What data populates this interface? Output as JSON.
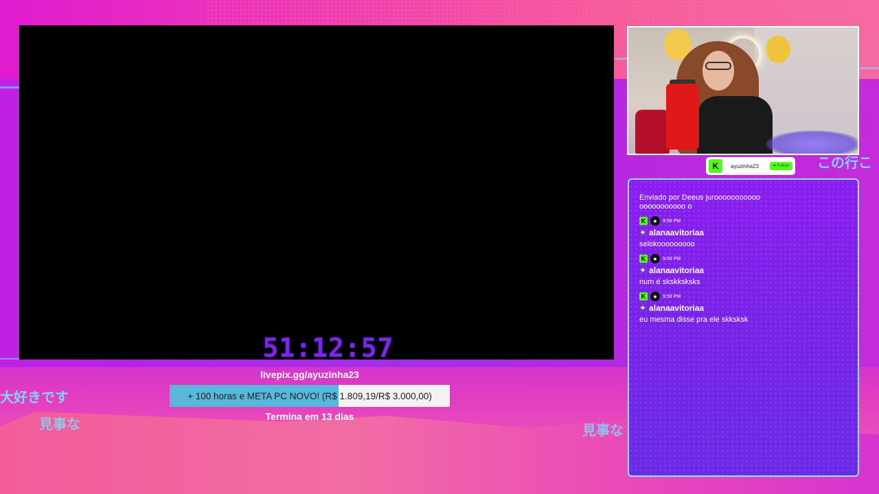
{
  "overlay": {
    "jp_texts": [
      "大好きです",
      "見事な",
      "見事な",
      "この行こ"
    ]
  },
  "stream": {
    "countdown": "51:12:57"
  },
  "webcam": {
    "alt": "streamer webcam"
  },
  "follow_bar": {
    "badge": "K",
    "channel": "ayuzinha23",
    "button_label": "Follow"
  },
  "chat": {
    "messages": [
      {
        "text": "Enviado por Deeus juroooooooooooooooooooooo o"
      },
      {
        "time": "9:58 PM",
        "user": "alanaavitoriaa",
        "text": "selokooooooooo"
      },
      {
        "time": "9:59 PM",
        "user": "alanaavitoriaa",
        "text": "num é skskksksks"
      },
      {
        "time": "9:59 PM",
        "user": "alanaavitoriaa",
        "text": "eu mesma disse pra ele skksksk"
      }
    ]
  },
  "donation": {
    "url": "livepix.gg/ayuzinha23",
    "goal_text": "+ 100 horas e META PC NOVO! (R$ 1.809,19/R$ 3.000,00)",
    "progress_fraction": 0.603,
    "ends": "Termina em 13 dias"
  },
  "colors": {
    "kick_green": "#53fc18",
    "timer_purple": "#7a28e8",
    "chat_border": "#8fe4ff",
    "progress_blue": "#57b8dc"
  }
}
